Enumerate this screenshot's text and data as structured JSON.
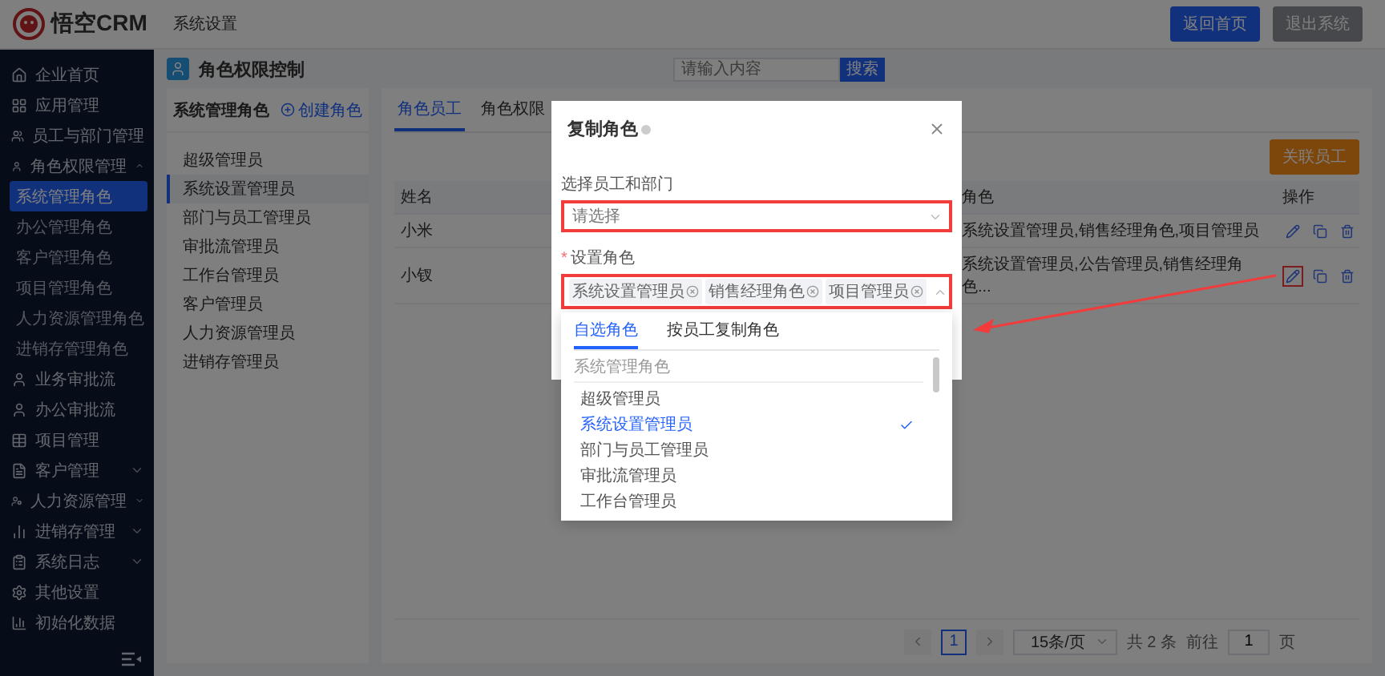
{
  "header": {
    "logo_text": "悟空CRM",
    "nav_title": "系统设置",
    "buttons": [
      {
        "label": "返回首页",
        "kind": "primary"
      },
      {
        "label": "退出系统",
        "kind": "secondary"
      }
    ]
  },
  "sidebar": {
    "items": [
      {
        "label": "企业首页",
        "selected": false
      },
      {
        "label": "应用管理",
        "selected": false
      },
      {
        "label": "员工与部门管理",
        "selected": false
      },
      {
        "label": "角色权限管理",
        "selected": false,
        "expanded": true,
        "children": [
          {
            "label": "系统管理角色",
            "selected": true
          },
          {
            "label": "办公管理角色",
            "selected": false
          },
          {
            "label": "客户管理角色",
            "selected": false
          },
          {
            "label": "项目管理角色",
            "selected": false
          },
          {
            "label": "人力资源管理角色",
            "selected": false
          },
          {
            "label": "进销存管理角色",
            "selected": false
          }
        ]
      },
      {
        "label": "业务审批流",
        "selected": false
      },
      {
        "label": "办公审批流",
        "selected": false
      },
      {
        "label": "项目管理",
        "selected": false
      },
      {
        "label": "客户管理",
        "selected": false,
        "expanded": false
      },
      {
        "label": "人力资源管理",
        "selected": false,
        "expanded": false
      },
      {
        "label": "进销存管理",
        "selected": false,
        "expanded": false
      },
      {
        "label": "系统日志",
        "selected": false,
        "expanded": false
      },
      {
        "label": "其他设置",
        "selected": false
      },
      {
        "label": "初始化数据",
        "selected": false
      }
    ]
  },
  "page": {
    "title": "角色权限控制",
    "search": {
      "placeholder": "请输入内容",
      "button": "搜索"
    }
  },
  "role_panel": {
    "title": "系统管理角色",
    "create": "创建角色",
    "roles": [
      {
        "label": "超级管理员",
        "selected": false
      },
      {
        "label": "系统设置管理员",
        "selected": true
      },
      {
        "label": "部门与员工管理员",
        "selected": false
      },
      {
        "label": "审批流管理员",
        "selected": false
      },
      {
        "label": "工作台管理员",
        "selected": false
      },
      {
        "label": "客户管理员",
        "selected": false
      },
      {
        "label": "人力资源管理员",
        "selected": false
      },
      {
        "label": "进销存管理员",
        "selected": false
      }
    ]
  },
  "staff_panel": {
    "tabs": [
      {
        "label": "角色员工",
        "selected": true
      },
      {
        "label": "角色权限",
        "selected": false
      }
    ],
    "link_button": "关联员工",
    "table": {
      "columns": [
        "姓名",
        "角色",
        "操作"
      ],
      "rows": [
        {
          "name": "小米",
          "roles": "系统设置管理员,销售经理角色,项目管理员",
          "highlighted": false
        },
        {
          "name": "小钗",
          "roles": "系统设置管理员,公告管理员,销售经理角色...",
          "highlighted": true
        }
      ]
    },
    "pagination": {
      "pages": [
        {
          "label": "1",
          "selected": true
        }
      ],
      "page_size": "15条/页",
      "total": "共 2 条",
      "goto_label": "前往",
      "goto_value": "1",
      "goto_suffix": "页"
    }
  },
  "dialog": {
    "title": "复制角色",
    "staff_field": {
      "label": "选择员工和部门",
      "placeholder": "请选择",
      "highlighted": true
    },
    "role_field": {
      "label": "设置角色",
      "required_mark": "*",
      "highlighted": true,
      "expanded": true,
      "tags": [
        "系统设置管理员",
        "销售经理角色",
        "项目管理员"
      ]
    },
    "dropdown": {
      "tabs": [
        {
          "label": "自选角色",
          "selected": true
        },
        {
          "label": "按员工复制角色",
          "selected": false
        }
      ],
      "group": "系统管理角色",
      "options": [
        {
          "label": "超级管理员",
          "selected": false
        },
        {
          "label": "系统设置管理员",
          "selected": true
        },
        {
          "label": "部门与员工管理员",
          "selected": false
        },
        {
          "label": "审批流管理员",
          "selected": false
        },
        {
          "label": "工作台管理员",
          "selected": false
        }
      ]
    }
  }
}
